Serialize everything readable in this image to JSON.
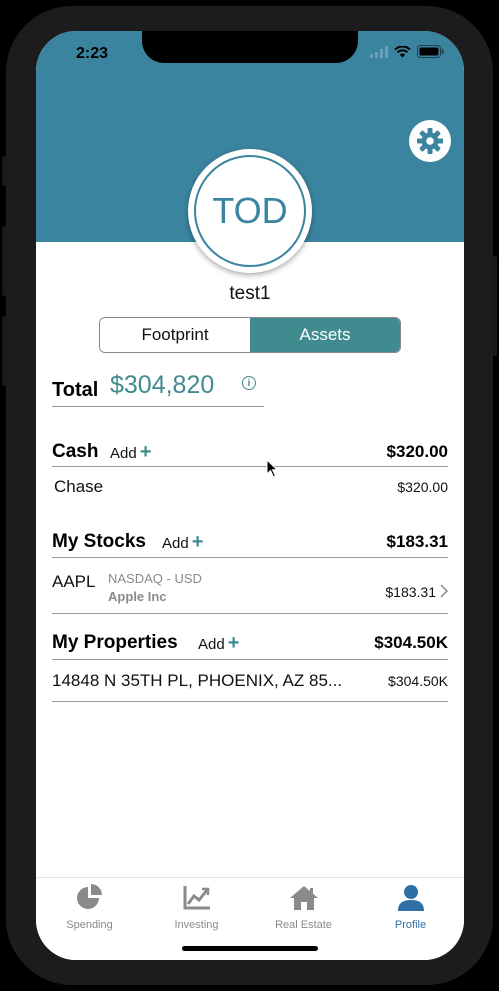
{
  "status_bar": {
    "time": "2:23"
  },
  "profile": {
    "initials": "TOD",
    "username": "test1"
  },
  "segments": [
    {
      "label": "Footprint",
      "active": false
    },
    {
      "label": "Assets",
      "active": true
    }
  ],
  "total": {
    "label": "Total",
    "value": "$304,820"
  },
  "add_label": "Add",
  "cash": {
    "title": "Cash",
    "total": "$320.00",
    "items": [
      {
        "name": "Chase",
        "value": "$320.00"
      }
    ]
  },
  "stocks": {
    "title": "My Stocks",
    "total": "$183.31",
    "items": [
      {
        "symbol": "AAPL",
        "exchange": "NASDAQ - USD",
        "company": "Apple Inc",
        "value": "$183.31"
      }
    ]
  },
  "properties": {
    "title": "My Properties",
    "total": "$304.50K",
    "items": [
      {
        "address": "14848 N 35TH PL, PHOENIX, AZ 85...",
        "value": "$304.50K"
      }
    ]
  },
  "tabs": [
    {
      "label": "Spending",
      "icon": "pie-chart-icon",
      "active": false
    },
    {
      "label": "Investing",
      "icon": "line-chart-icon",
      "active": false
    },
    {
      "label": "Real Estate",
      "icon": "house-icon",
      "active": false
    },
    {
      "label": "Profile",
      "icon": "person-icon",
      "active": true
    }
  ],
  "colors": {
    "header": "#3b84a0",
    "accent": "#3f8b8f",
    "active_tab": "#2f6fa6"
  }
}
